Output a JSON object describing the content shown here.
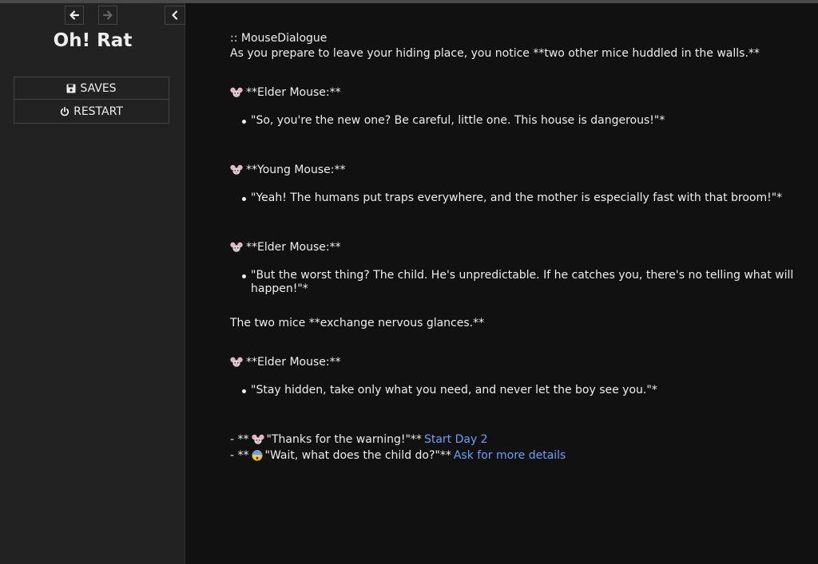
{
  "sidebar": {
    "title": "Oh! Rat",
    "nav": {
      "back_icon": "arrow-left-icon",
      "forward_icon": "arrow-right-icon",
      "stow_icon": "chevron-left-icon"
    },
    "menu": {
      "saves_label": "Saves",
      "restart_label": "Restart"
    }
  },
  "passage": {
    "title_line": ":: MouseDialogue",
    "intro": "As you prepare to leave your hiding place, you notice **two other mice huddled in the walls.**",
    "dialogue": [
      {
        "speaker": "**Elder Mouse:**",
        "line": "\"So, you're the new one? Be careful, little one. This house is dangerous!\"*"
      },
      {
        "speaker": "**Young Mouse:**",
        "line": "\"Yeah! The humans put traps everywhere, and the mother is especially fast with that broom!\"*"
      },
      {
        "speaker": "**Elder Mouse:**",
        "line": "\"But the worst thing? The child. He's unpredictable. If he catches you, there's no telling what will happen!\"*"
      }
    ],
    "narration": "The two mice **exchange nervous glances.**",
    "final": {
      "speaker": "**Elder Mouse:**",
      "line": "\"Stay hidden, take only what you need, and never let the boy see you.\"*"
    },
    "choices": [
      {
        "prefix": "- **",
        "text": "\"Thanks for the warning!\"**",
        "link": "Start Day 2"
      },
      {
        "prefix": "- **",
        "text": "\"Wait, what does the child do?\"**",
        "link": "Ask for more details"
      }
    ]
  },
  "colors": {
    "background": "#111111",
    "sidebar": "#222222",
    "link": "#68a0ff"
  },
  "icons": [
    "mouse-face-icon",
    "scared-face-icon",
    "floppy-disk-icon",
    "power-icon"
  ]
}
